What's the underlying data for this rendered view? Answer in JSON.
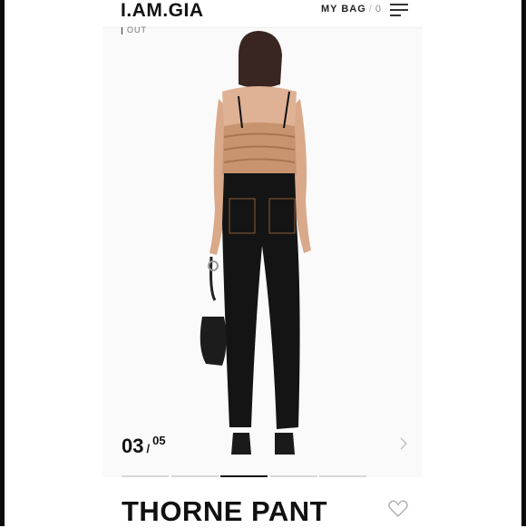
{
  "brand": {
    "logo": "I.AM.GIA"
  },
  "header": {
    "bag_label": "MY BAG",
    "bag_separator": "/",
    "bag_count": "0"
  },
  "gallery": {
    "corner_label": "OUT",
    "current": "03",
    "separator": "/",
    "total": "05",
    "active_index": 3
  },
  "product": {
    "title": "THORNE PANT"
  },
  "colors": {
    "frame": "#0b0b0b",
    "accent": "#111111",
    "inactive_dot": "#d8d8d8"
  }
}
